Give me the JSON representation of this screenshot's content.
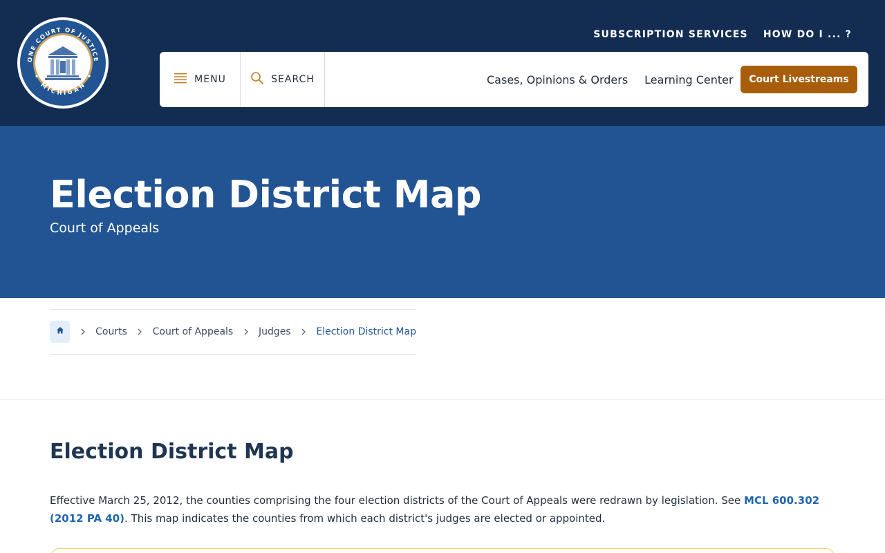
{
  "header": {
    "seal": {
      "top_text": "ONE COURT OF JUSTICE",
      "bottom_text": "MICHIGAN"
    },
    "utility_links": [
      "SUBSCRIPTION SERVICES",
      "HOW DO I ... ?"
    ],
    "nav": {
      "menu_label": "MENU",
      "search_label": "SEARCH",
      "links": [
        "Cases, Opinions & Orders",
        "Learning Center"
      ],
      "livestream_label": "Court Livestreams"
    }
  },
  "hero": {
    "title": "Election District Map",
    "subtitle": "Court of Appeals"
  },
  "breadcrumb": {
    "items": [
      "Courts",
      "Court of Appeals",
      "Judges",
      "Election District Map"
    ]
  },
  "content": {
    "title": "Election District Map",
    "paragraph_start": "Effective March 25, 2012, the counties comprising the four election districts of the Court of Appeals were redrawn by legislation. See ",
    "link_text": "MCL 600.302 (2012 PA 40)",
    "paragraph_end": ". This map indicates the counties from which each district's judges are elected or appointed."
  },
  "colors": {
    "header_bg": "#132d52",
    "hero_bg": "#225493",
    "accent_orange": "#a85d0a",
    "link_blue": "#2066b0"
  }
}
